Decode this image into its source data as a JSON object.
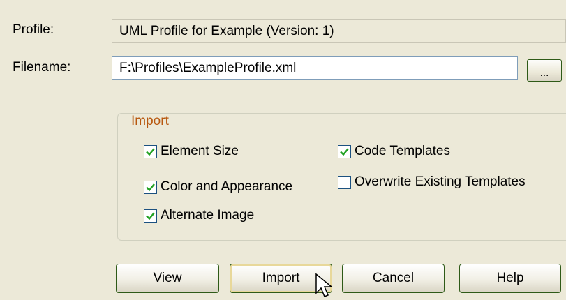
{
  "profile": {
    "label": "Profile:",
    "value": "UML Profile for Example (Version: 1)"
  },
  "filename": {
    "label": "Filename:",
    "value": "F:\\Profiles\\ExampleProfile.xml",
    "browse_label": "..."
  },
  "import_group": {
    "legend": "Import",
    "options": [
      {
        "label": "Element Size",
        "checked": true
      },
      {
        "label": "Color and Appearance",
        "checked": true
      },
      {
        "label": "Alternate Image",
        "checked": true
      },
      {
        "label": "Code Templates",
        "checked": true
      },
      {
        "label": "Overwrite Existing Templates",
        "checked": false
      }
    ]
  },
  "buttons": {
    "view": "View",
    "import": "Import",
    "cancel": "Cancel",
    "help": "Help"
  },
  "colors": {
    "background": "#ece9d8",
    "legend_text": "#b8580f",
    "check_mark": "#21a121",
    "button_border": "#2e5a17"
  }
}
